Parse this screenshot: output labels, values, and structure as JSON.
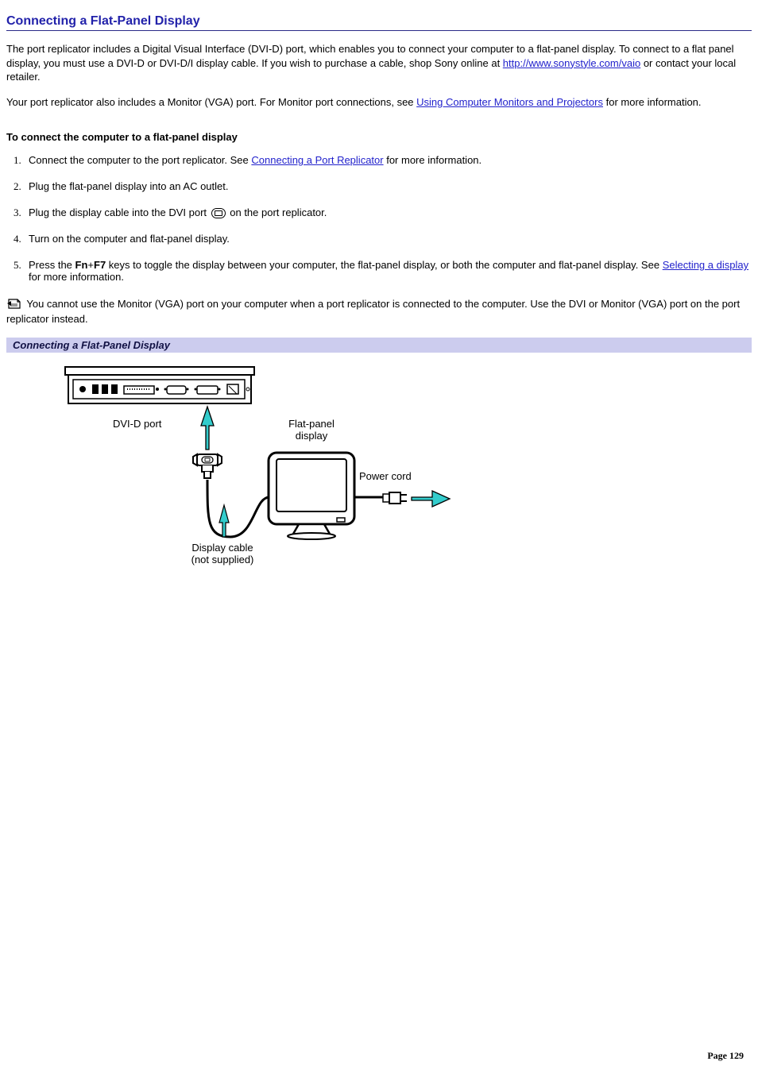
{
  "title": "Connecting a Flat-Panel Display",
  "intro": {
    "p1_a": "The port replicator includes a Digital Visual Interface (DVI-D) port, which enables you to connect your computer to a flat-panel display. To connect to a flat panel display, you must use a DVI-D or DVI-D/I display cable. If you wish to purchase a cable, shop Sony online at ",
    "link1": "http://www.sonystyle.com/vaio",
    "p1_b": " or contact your local retailer.",
    "p2_a": "Your port replicator also includes a Monitor (VGA) port. For Monitor port connections, see ",
    "link2": "Using Computer Monitors and Projectors",
    "p2_b": " for more information."
  },
  "section_heading": "To connect the computer to a flat-panel display",
  "steps": {
    "s1_a": "Connect the computer to the port replicator. See ",
    "s1_link": "Connecting a Port Replicator",
    "s1_b": " for more information.",
    "s2": "Plug the flat-panel display into an AC outlet.",
    "s3_a": "Plug the display cable into the DVI port ",
    "s3_b": " on the port replicator.",
    "s4": "Turn on the computer and flat-panel display.",
    "s5_a": "Press the ",
    "s5_fn": "Fn",
    "s5_plus": "+",
    "s5_f7": "F7",
    "s5_b": " keys to toggle the display between your computer, the flat-panel display, or both the computer and flat-panel display. See ",
    "s5_link": "Selecting a display",
    "s5_c": " for more information."
  },
  "note": " You cannot use the Monitor (VGA) port on your computer when a port replicator is connected to the computer. Use the DVI or Monitor (VGA) port on the port replicator instead.",
  "caption": "Connecting a Flat-Panel Display",
  "figure_labels": {
    "dvi": "DVI-D port",
    "flat": "Flat-panel display",
    "power": "Power cord",
    "cable_l1": "Display cable",
    "cable_l2": "(not supplied)"
  },
  "page_number": "Page 129"
}
